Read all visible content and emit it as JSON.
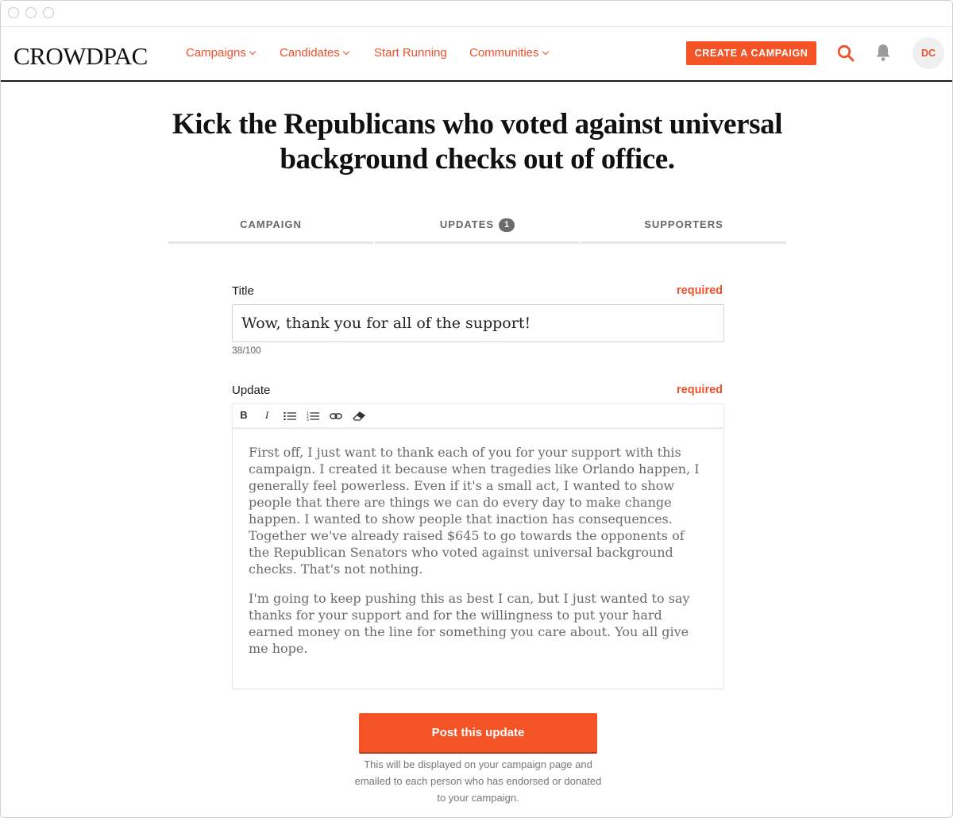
{
  "brand": {
    "logo": "CROWDPAC"
  },
  "nav": {
    "items": [
      {
        "label": "Campaigns",
        "dropdown": true
      },
      {
        "label": "Candidates",
        "dropdown": true
      },
      {
        "label": "Start Running",
        "dropdown": false
      },
      {
        "label": "Communities",
        "dropdown": true
      }
    ],
    "create_label": "CREATE A CAMPAIGN",
    "search_icon": "search-icon",
    "notifications_icon": "bell-icon",
    "avatar_initials": "DC"
  },
  "page": {
    "title": "Kick the Republicans who voted against universal background checks out of office."
  },
  "tabs": [
    {
      "label": "CAMPAIGN"
    },
    {
      "label": "UPDATES",
      "badge": "1"
    },
    {
      "label": "SUPPORTERS"
    }
  ],
  "form": {
    "title_label": "Title",
    "title_required": "required",
    "title_value": "Wow, thank you for all of the support!",
    "title_counter": "38/100",
    "update_label": "Update",
    "update_required": "required",
    "toolbar": [
      "bold-icon",
      "italic-icon",
      "bulleted-list-icon",
      "numbered-list-icon",
      "link-icon",
      "eraser-icon"
    ],
    "update_paragraphs": [
      "First off, I just want to thank each of you for your support with this campaign. I created it because when tragedies like Orlando happen, I generally feel powerless. Even if it's a small act, I wanted to show people that there are things we can do every day to make change happen. I wanted to show people that inaction has consequences. Together we've already raised $645 to go towards the opponents of the Republican Senators who voted against universal background checks. That's not nothing.",
      "I'm going to keep pushing this as best I can, but I just wanted to say thanks for your support and for the willingness to put your hard earned money on the line for something you care about. You all give me hope."
    ],
    "submit_label": "Post this update",
    "submit_note": "This will be displayed on your campaign page and emailed to each person who has endorsed or donated to your campaign."
  },
  "colors": {
    "accent": "#f35325",
    "accent_text": "#f0502a",
    "text": "#222222",
    "muted": "#777777"
  }
}
